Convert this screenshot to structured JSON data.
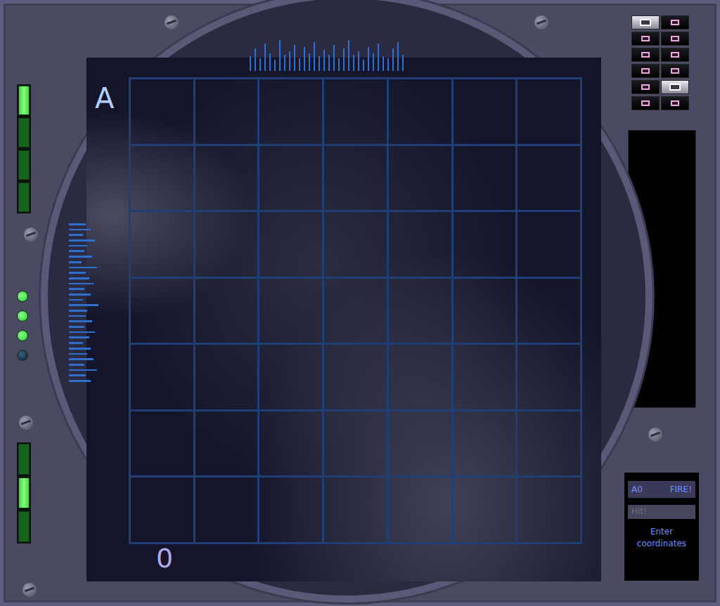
{
  "board": {
    "row_label": "A",
    "column_label": "0"
  },
  "left_meters": [
    {
      "segments": [
        {
          "on": true
        },
        {
          "on": false
        },
        {
          "on": false
        },
        {
          "on": false
        }
      ]
    },
    {
      "segments": [
        {
          "on": false
        },
        {
          "on": true
        },
        {
          "on": false
        }
      ]
    }
  ],
  "leds": [
    {
      "on": true
    },
    {
      "on": true
    },
    {
      "on": true
    },
    {
      "on": false
    }
  ],
  "top_spectrum": [
    0.45,
    0.7,
    0.4,
    0.85,
    0.55,
    0.35,
    0.95,
    0.5,
    0.6,
    0.8,
    0.4,
    0.75,
    0.55,
    0.9,
    0.45,
    0.65,
    0.5,
    0.8,
    0.4,
    0.7,
    0.95,
    0.5,
    0.6,
    0.35,
    0.75,
    0.55,
    0.85,
    0.45,
    0.4,
    0.7,
    0.9,
    0.5
  ],
  "left_spectrum": [
    0.55,
    0.7,
    0.45,
    0.85,
    0.6,
    0.5,
    0.75,
    0.4,
    0.9,
    0.55,
    0.65,
    0.8,
    0.5,
    0.7,
    0.45,
    0.95,
    0.6,
    0.55,
    0.75,
    0.5,
    0.85,
    0.65,
    0.45,
    0.7,
    0.6,
    0.8,
    0.5,
    0.9,
    0.55,
    0.7
  ],
  "ships": [
    {
      "selected": true
    },
    {
      "selected": false
    },
    {
      "selected": false
    },
    {
      "selected": false
    },
    {
      "selected": false
    },
    {
      "selected": false
    },
    {
      "selected": false
    },
    {
      "selected": false
    },
    {
      "selected": false
    },
    {
      "selected": true
    },
    {
      "selected": false
    },
    {
      "selected": false
    }
  ],
  "control": {
    "coordinate": "A0",
    "fire_button": "FIRE!",
    "result": "Hit!",
    "hint": "Enter coordinates"
  }
}
